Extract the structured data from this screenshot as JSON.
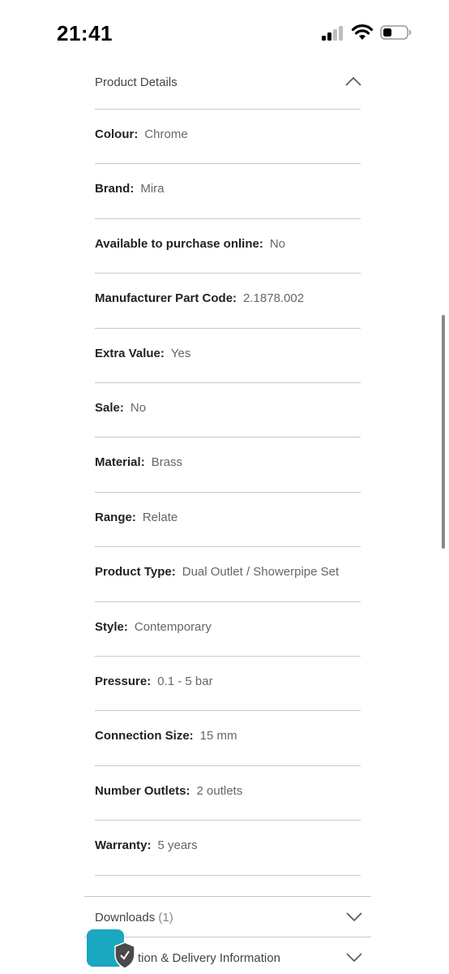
{
  "status_bar": {
    "time": "21:41"
  },
  "product_details": {
    "title": "Product Details",
    "expanded": true,
    "specs": [
      {
        "label": "Colour:",
        "value": "Chrome"
      },
      {
        "label": "Brand:",
        "value": "Mira"
      },
      {
        "label": "Available to purchase online:",
        "value": "No"
      },
      {
        "label": "Manufacturer Part Code:",
        "value": "2.1878.002"
      },
      {
        "label": "Extra Value:",
        "value": "Yes"
      },
      {
        "label": "Sale:",
        "value": "No"
      },
      {
        "label": "Material:",
        "value": "Brass"
      },
      {
        "label": "Range:",
        "value": "Relate"
      },
      {
        "label": "Product Type:",
        "value": "Dual Outlet / Showerpipe Set"
      },
      {
        "label": "Style:",
        "value": "Contemporary"
      },
      {
        "label": "Pressure:",
        "value": "0.1 - 5 bar"
      },
      {
        "label": "Connection Size:",
        "value": "15 mm"
      },
      {
        "label": "Number Outlets:",
        "value": "2 outlets"
      },
      {
        "label": "Warranty:",
        "value": "5 years"
      }
    ]
  },
  "downloads": {
    "label": "Downloads",
    "count": "(1)"
  },
  "delivery": {
    "label": "tion & Delivery Information"
  },
  "colors": {
    "accent": "#1aa7c0",
    "divider": "#c8c8c8"
  },
  "icons": {
    "chevron_up": "chevron-up-icon",
    "chevron_down": "chevron-down-icon",
    "shield": "shield-check-icon"
  }
}
